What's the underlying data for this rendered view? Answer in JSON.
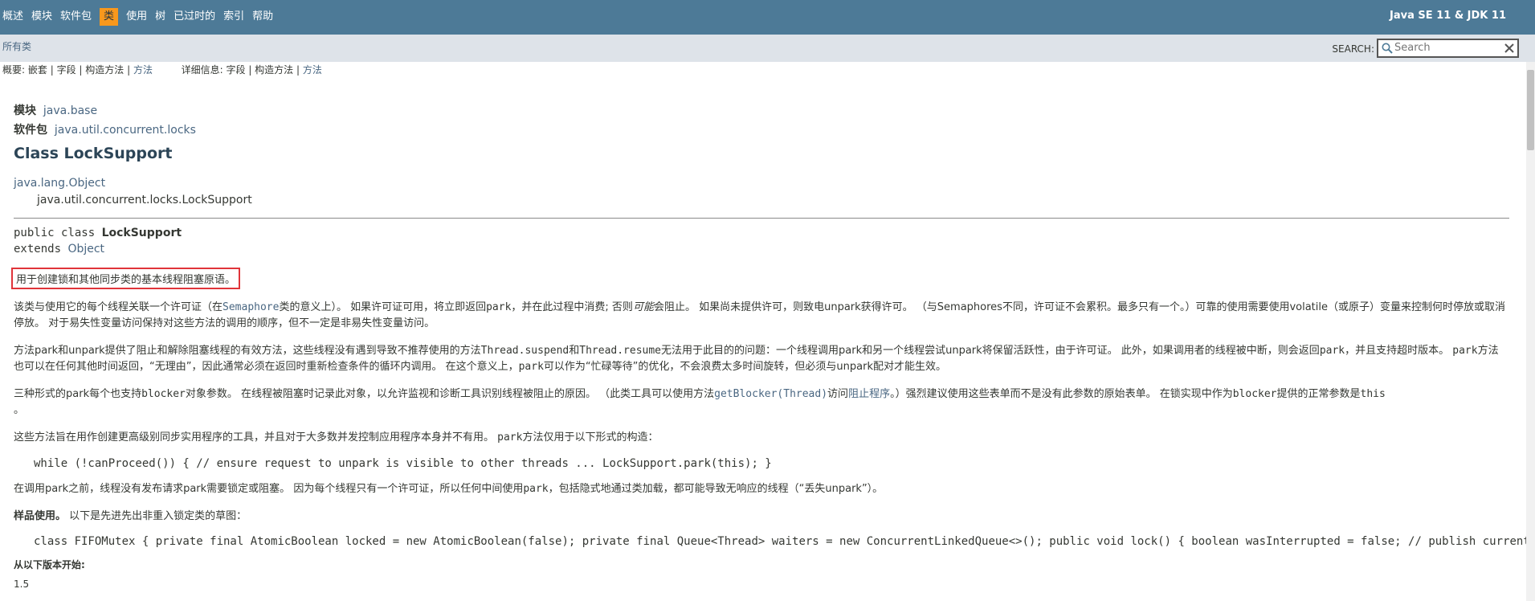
{
  "topnav": {
    "items": [
      "概述",
      "模块",
      "软件包",
      "类",
      "使用",
      "树",
      "已过时的",
      "索引",
      "帮助"
    ],
    "active_index": 3,
    "about": "Java SE 11 & JDK 11"
  },
  "subnav": {
    "all_classes": "所有类",
    "search_label": "SEARCH:",
    "search_placeholder": "Search"
  },
  "summary": {
    "summary_label": "概要:",
    "summary_items": [
      "嵌套",
      "字段",
      "构造方法",
      "方法"
    ],
    "detail_label": "详细信息:",
    "detail_items": [
      "字段",
      "构造方法",
      "方法"
    ]
  },
  "header": {
    "module_label": "模块",
    "module_link": "java.base",
    "package_label": "软件包",
    "package_link": "java.util.concurrent.locks",
    "title": "Class LockSupport"
  },
  "inheritance": {
    "parent": "java.lang.Object",
    "child": "java.util.concurrent.locks.LockSupport"
  },
  "declaration": {
    "prefix": "public class ",
    "name": "LockSupport",
    "extends": "extends ",
    "extends_link": "Object"
  },
  "description": {
    "summary": "用于创建锁和其他同步类的基本线程阻塞原语。",
    "p1_a": "该类与使用它的每个线程关联一个许可证（在",
    "p1_link": "Semaphore",
    "p1_b": "类的意义上）。 如果许可证可用，将立即返回",
    "p1_code": "park",
    "p1_c": "，并在此过程中消费; 否则",
    "p1_em": "可能",
    "p1_d": "会阻止。 如果尚未提供许可，则致电unpark获得许可。 （与Semaphores不同，许可证不会累积。最多只有一个。）可靠的使用需要使用volatile（或原子）变量来控制何时停放或取消停放。 对于易失性变量访问保持对这些方法的调用的顺序，但不一定是非易失性变量访问。",
    "p2_a": "方法park和unpark提供了阻止和解除阻塞线程的有效方法，这些线程没有遇到导致不推荐使用的方法",
    "p2_code1": "Thread.suspend",
    "p2_and": "和",
    "p2_code2": "Thread.resume",
    "p2_b": "无法用于此目的的问题：一个线程调用park和另一个线程尝试unpark将保留活跃性，由于许可证。 此外，如果调用者的线程被中断，则会返回",
    "p2_code3": "park",
    "p2_c": "，并且支持超时版本。",
    "p2_code4": "park",
    "p2_d": "方法也可以在任何其他时间返回，“无理由”，因此通常必须在返回时重新检查条件的循环内调用。 在这个意义上，",
    "p2_code5": "park",
    "p2_e": "可以作为“忙碌等待”的优化，不会浪费太多时间旋转，但必须与",
    "p2_code6": "unpark",
    "p2_f": "配对才能生效。",
    "p3_a": "三种形式的park每个也支持",
    "p3_code1": "blocker",
    "p3_b": "对象参数。 在线程被阻塞时记录此对象，以允许监视和诊断工具识别线程被阻止的原因。 （此类工具可以使用方法",
    "p3_link1": "getBlocker(Thread)",
    "p3_c": "访问",
    "p3_link2": "阻止程序",
    "p3_d": "。）强烈建议使用这些表单而不是没有此参数的原始表单。 在锁实现中作为",
    "p3_code2": "blocker",
    "p3_e": "提供的正常参数是",
    "p3_code3": "this",
    "p3_f": "。",
    "p4_a": "这些方法旨在用作创建更高级别同步实用程序的工具，并且对于大多数并发控制应用程序本身并不有用。",
    "p4_code": "park",
    "p4_b": "方法仅用于以下形式的构造：",
    "code1": "while (!canProceed()) { // ensure request to unpark is visible to other threads ... LockSupport.park(this); }",
    "p5_a": "在调用park之前，线程没有发布请求park需要锁定或阻塞。 因为每个线程只有一个许可证，所以任何中间使用",
    "p5_code": "park",
    "p5_b": "，包括隐式地通过类加载，都可能导致无响应的线程（“丢失unpark”）。",
    "sample_bold": "样品使用。",
    "sample_text": " 以下是先进先出非重入锁定类的草图：",
    "code2": "class FIFOMutex { private final AtomicBoolean locked = new AtomicBoolean(false); private final Queue<Thread> waiters = new ConcurrentLinkedQueue<>(); public void lock() { boolean wasInterrupted = false; // publish current",
    "since_label": "从以下版本开始:",
    "since_value": "1.5"
  }
}
